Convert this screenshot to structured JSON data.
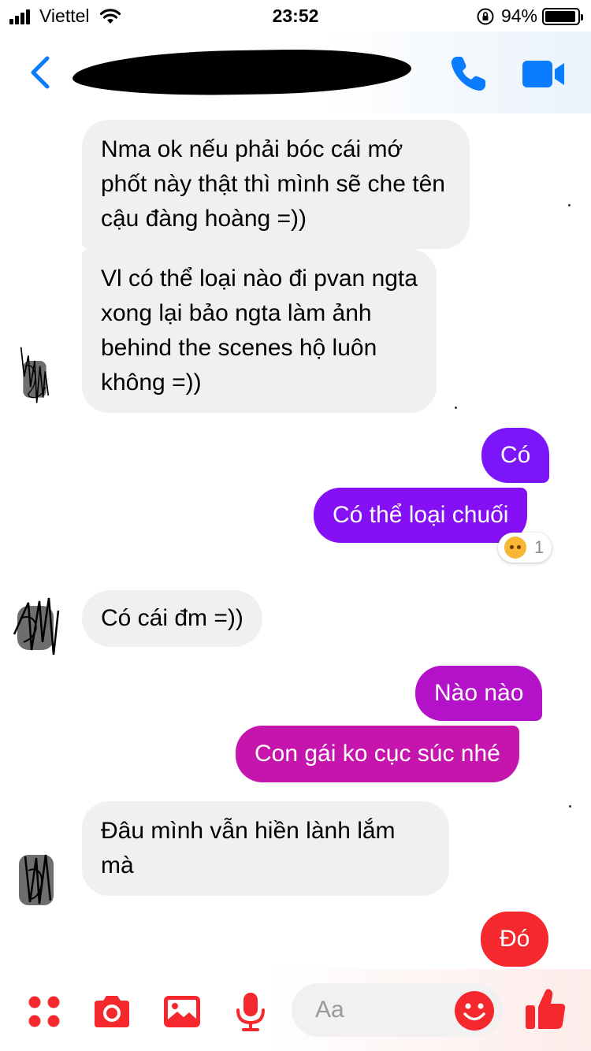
{
  "status_bar": {
    "carrier": "Viettel",
    "time": "23:52",
    "battery_percent": "94%",
    "battery_level": 0.94
  },
  "header": {
    "contact_name": "",
    "accent_color": "#0a7cff"
  },
  "messages": [
    {
      "side": "incoming",
      "text": "Nma ok nếu phải bóc cái mớ phốt này thật thì mình sẽ che tên cậu đàng hoàng =))"
    },
    {
      "side": "incoming",
      "text": "Vl có thể loại nào đi pvan ngta xong lại bảo ngta làm ảnh behind the scenes hộ luôn không =))"
    },
    {
      "side": "outgoing",
      "text": "Có",
      "color": "#7b16fb"
    },
    {
      "side": "outgoing",
      "text": "Có thể loại chuối",
      "color": "#8610f5",
      "reaction": {
        "emoji": "angry-face",
        "count": "1"
      }
    },
    {
      "side": "incoming",
      "text": "Có cái đm =))"
    },
    {
      "side": "outgoing",
      "text": "Nào nào",
      "color": "#b412c8"
    },
    {
      "side": "outgoing",
      "text": "Con gái ko cục súc nhé",
      "color": "#c615ad"
    },
    {
      "side": "incoming",
      "text": "Đâu mình vẫn hiền lành lắm mà"
    },
    {
      "side": "outgoing",
      "text": "Đó",
      "color": "#f5292d"
    }
  ],
  "composer": {
    "placeholder": "Aa",
    "icons": [
      "more-icon",
      "camera-icon",
      "photo-icon",
      "mic-icon",
      "emoji-icon",
      "thumbs-up-icon"
    ],
    "accent_color": "#f5292d"
  }
}
